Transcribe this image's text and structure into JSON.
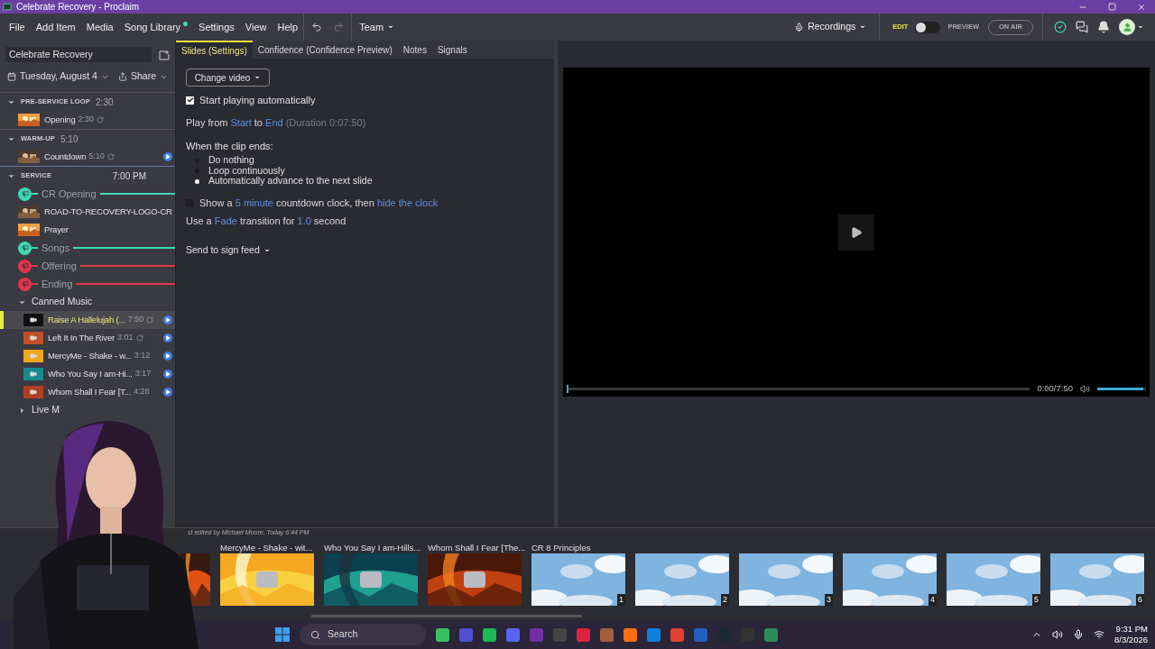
{
  "window": {
    "title": "Celebrate Recovery - Proclaim"
  },
  "menu": [
    {
      "label": "File",
      "online": false
    },
    {
      "label": "Add Item",
      "online": false
    },
    {
      "label": "Media",
      "online": false
    },
    {
      "label": "Song Library",
      "online": true
    },
    {
      "label": "Settings",
      "online": false
    },
    {
      "label": "View",
      "online": false
    },
    {
      "label": "Help",
      "online": false
    }
  ],
  "team_menu": "Team",
  "recordings": "Recordings",
  "mode": {
    "edit": "EDIT",
    "preview": "PREVIEW",
    "on": false
  },
  "on_air": "ON AIR",
  "sidebar": {
    "presentation": "Celebrate Recovery",
    "date": "Tuesday, August 4",
    "share": "Share",
    "sections": [
      {
        "name": "PRE-SERVICE LOOP",
        "time": "2:30",
        "expanded": true,
        "items": [
          {
            "kind": "media",
            "title": "Opening",
            "duration": "2:30",
            "loop": true,
            "play": false,
            "selected": false
          }
        ]
      },
      {
        "name": "WARM-UP",
        "time": "5:10",
        "expanded": true,
        "items": [
          {
            "kind": "media",
            "title": "Countdown",
            "duration": "5:10",
            "loop": true,
            "play": true,
            "selected": false
          }
        ]
      },
      {
        "name": "SERVICE",
        "start": "7:00 PM",
        "expanded": true,
        "items": [
          {
            "kind": "signal",
            "title": "CR Opening",
            "color": "#3dd9b4"
          },
          {
            "kind": "media",
            "title": "ROAD-TO-RECOVERY-LOGO-CR",
            "loop": false,
            "play": false,
            "selected": false
          },
          {
            "kind": "media",
            "title": "Prayer",
            "loop": false,
            "play": false,
            "selected": false
          },
          {
            "kind": "signal",
            "title": "Songs",
            "color": "#3dd9b4"
          },
          {
            "kind": "signal",
            "title": "Offering",
            "color": "#e0364a"
          },
          {
            "kind": "signal",
            "title": "Ending",
            "color": "#e0364a"
          },
          {
            "kind": "group",
            "title": "Canned Music",
            "expanded": true,
            "children": [
              {
                "kind": "media",
                "title": "Raise A Hallelujah (...",
                "duration": "7:50",
                "loop": true,
                "play": true,
                "selected": true
              },
              {
                "kind": "media",
                "title": "Left It In The River",
                "duration": "3:01",
                "loop": true,
                "play": true,
                "selected": false
              },
              {
                "kind": "media",
                "title": "MercyMe - Shake - w...",
                "duration": "3:12",
                "loop": false,
                "play": true,
                "selected": false
              },
              {
                "kind": "media",
                "title": "Who You Say I am-Hi...",
                "duration": "3:17",
                "loop": false,
                "play": true,
                "selected": false
              },
              {
                "kind": "media",
                "title": "Whom Shall I Fear [T...",
                "duration": "4:28",
                "loop": false,
                "play": true,
                "selected": false
              }
            ]
          },
          {
            "kind": "group",
            "title": "Live M",
            "expanded": false
          }
        ]
      }
    ]
  },
  "tabs": [
    {
      "label": "Slides (Settings)",
      "selected": true
    },
    {
      "label": "Confidence (Confidence Preview)",
      "selected": false
    },
    {
      "label": "Notes",
      "selected": false
    },
    {
      "label": "Signals",
      "selected": false
    }
  ],
  "settings": {
    "change_video": "Change video",
    "autoplay": {
      "label": "Start playing automatically",
      "checked": true
    },
    "play_range": [
      {
        "kind": "text",
        "text": "Play from "
      },
      {
        "kind": "link",
        "text": "Start"
      },
      {
        "kind": "text",
        "text": " to "
      },
      {
        "kind": "link",
        "text": "End"
      },
      {
        "kind": "note",
        "text": " (Duration 0:07:50)"
      }
    ],
    "clip_end_label": "When the clip ends:",
    "clip_end_options": [
      {
        "label": "Do nothing",
        "selected": false
      },
      {
        "label": "Loop continuously",
        "selected": false
      },
      {
        "label": "Automatically advance to the next slide",
        "selected": true
      }
    ],
    "countdown": {
      "checked": false,
      "parts": [
        {
          "kind": "text",
          "text": "Show a "
        },
        {
          "kind": "link",
          "text": "5 minute"
        },
        {
          "kind": "text",
          "text": " countdown clock, then "
        },
        {
          "kind": "link",
          "text": "hide the clock"
        }
      ]
    },
    "transition": [
      {
        "kind": "text",
        "text": "Use a "
      },
      {
        "kind": "link",
        "text": "Fade"
      },
      {
        "kind": "text",
        "text": " transition for "
      },
      {
        "kind": "link",
        "text": "1.0"
      },
      {
        "kind": "text",
        "text": " second"
      }
    ],
    "sign_feed": "Send to sign feed"
  },
  "preview": {
    "time": "0:00/7:50",
    "progress": {
      "level": 0
    },
    "volume": {
      "level": 0.95
    }
  },
  "edited": "st edited by Michael Moore, Today 6:44 PM",
  "slides": [
    {
      "kind": "picture"
    },
    {
      "kind": "video",
      "title": "MercyMe - Shake - wit..."
    },
    {
      "kind": "video",
      "title": "Who You Say I am-Hills..."
    },
    {
      "kind": "video",
      "title": "Whom Shall I Fear [The..."
    },
    {
      "kind": "text",
      "title": "CR 8 Principles",
      "number": "1"
    },
    {
      "kind": "text",
      "number": "2"
    },
    {
      "kind": "text",
      "number": "3"
    },
    {
      "kind": "text",
      "number": "4"
    },
    {
      "kind": "text",
      "number": "5"
    },
    {
      "kind": "text",
      "number": "6"
    }
  ],
  "taskbar": {
    "search": "Search",
    "time": "9:31 PM",
    "date": "8/3/2026"
  }
}
